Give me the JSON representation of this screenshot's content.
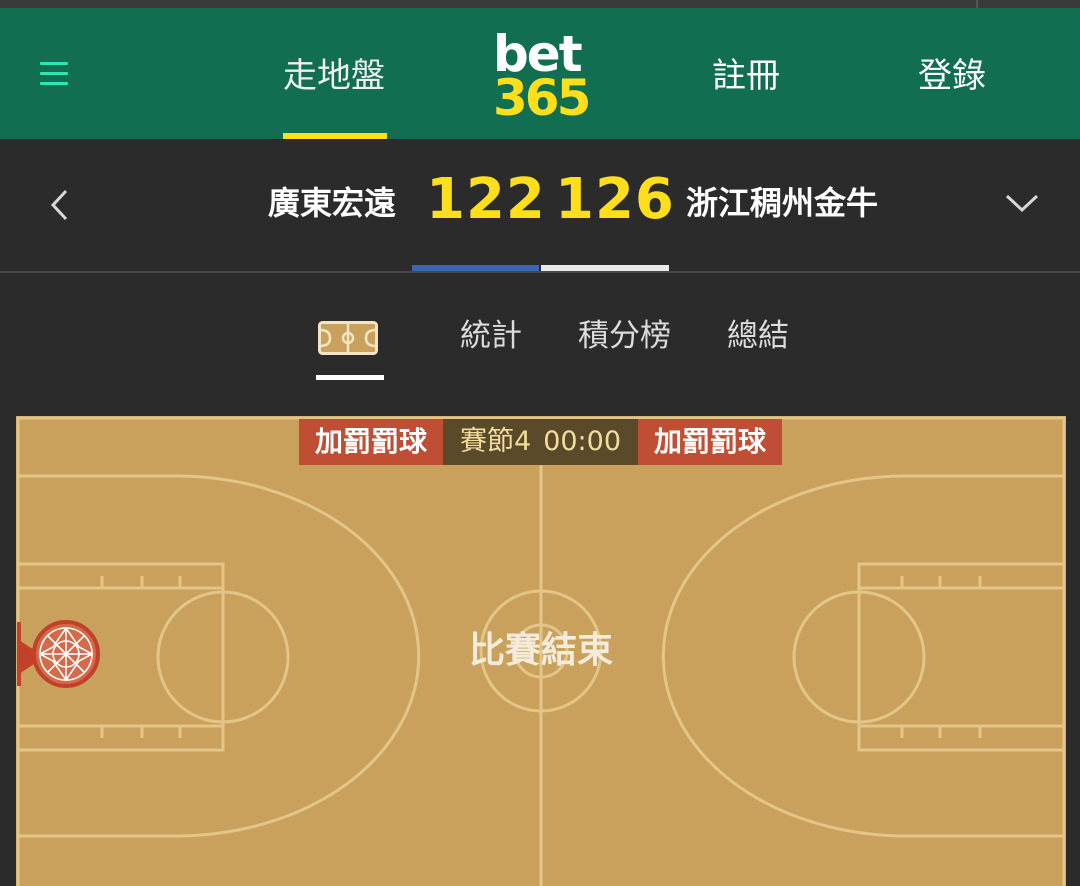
{
  "nav": {
    "live_label": "走地盤",
    "register_label": "註冊",
    "login_label": "登錄",
    "logo_line1": "bet",
    "logo_line2": "365",
    "colors": {
      "bar": "#126e51",
      "accent": "#ffdf1b"
    }
  },
  "scoreboard": {
    "home_team": "廣東宏遠",
    "home_score": "122",
    "away_score": "126",
    "away_team": "浙江稠州金牛",
    "colors": {
      "home": "#3b66b4",
      "away": "#e9e9e9"
    }
  },
  "tabs": {
    "court_icon": "basketball-court-icon",
    "stats_label": "統計",
    "standings_label": "積分榜",
    "summary_label": "總結"
  },
  "court": {
    "left_banner": "加罰罰球",
    "period_label": "賽節4",
    "clock": "00:00",
    "right_banner": "加罰罰球",
    "status": "比賽結束",
    "colors": {
      "floor": "#c9a15c",
      "lines": "#e0c07e",
      "banner": "#bf4e35"
    }
  }
}
